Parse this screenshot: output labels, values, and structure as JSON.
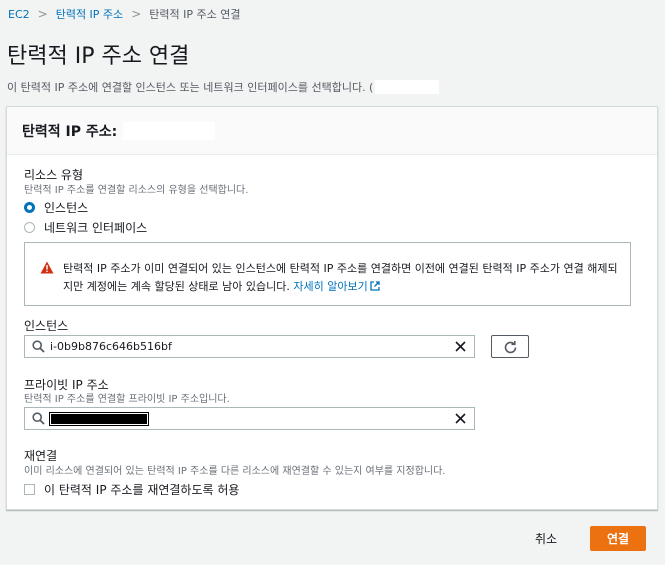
{
  "breadcrumb": {
    "items": [
      "EC2",
      "탄력적 IP 주소",
      "탄력적 IP 주소 연결"
    ]
  },
  "page": {
    "title": "탄력적 IP 주소 연결",
    "description": "이 탄력적 IP 주소에 연결할 인스턴스 또는 네트워크 인터페이스를 선택합니다. ("
  },
  "card": {
    "header": "탄력적 IP 주소:"
  },
  "resource_type": {
    "label": "리소스 유형",
    "description": "탄력적 IP 주소를 연결할 리소스의 유형을 선택합니다.",
    "options": [
      {
        "label": "인스턴스",
        "checked": true
      },
      {
        "label": "네트워크 인터페이스",
        "checked": false
      }
    ]
  },
  "alert": {
    "text": "탄력적 IP 주소가 이미 연결되어 있는 인스턴스에 탄력적 IP 주소를 연결하면 이전에 연결된 탄력적 IP 주소가 연결 해제되지만 계정에는 계속 할당된 상태로 남아 있습니다.",
    "link": "자세히 알아보기",
    "icon": "warning-icon",
    "icon_color": "#d13212"
  },
  "instance": {
    "label": "인스턴스",
    "value": "i-0b9b876c646b516bf"
  },
  "private_ip": {
    "label": "프라이빗 IP 주소",
    "description": "탄력적 IP 주소를 연결할 프라이빗 IP 주소입니다."
  },
  "reassociation": {
    "label": "재연결",
    "description": "이미 리소스에 연결되어 있는 탄력적 IP 주소를 다른 리소스에 재연결할 수 있는지 여부를 지정합니다.",
    "checkbox_label": "이 탄력적 IP 주소를 재연결하도록 허용",
    "checked": false
  },
  "footer": {
    "cancel_label": "취소",
    "submit_label": "연결"
  },
  "colors": {
    "link": "#0073bb",
    "primary": "#ec7211",
    "warning": "#d13212"
  }
}
